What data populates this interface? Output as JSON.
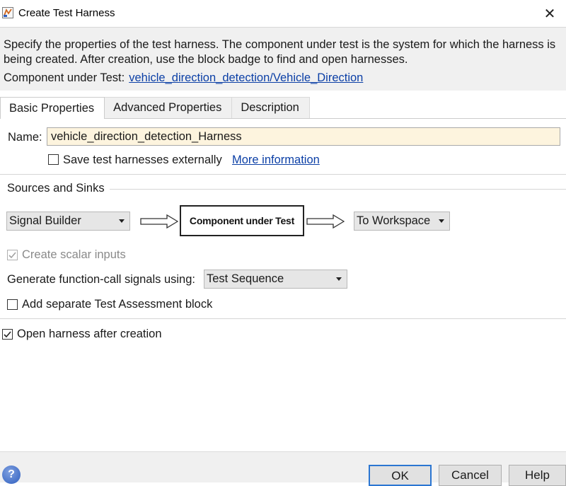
{
  "window": {
    "title": "Create Test Harness",
    "close_glyph": "✕"
  },
  "header": {
    "description": "Specify the properties of the test harness. The component under test is the system for which the harness is being created. After creation, use the block badge to find and open harnesses.",
    "component_label": "Component under Test:",
    "component_link": "vehicle_direction_detection/Vehicle_Direction"
  },
  "tabs": [
    {
      "label": "Basic Properties",
      "active": true
    },
    {
      "label": "Advanced Properties",
      "active": false
    },
    {
      "label": "Description",
      "active": false
    }
  ],
  "basic": {
    "name_label": "Name:",
    "name_value": "vehicle_direction_detection_Harness",
    "save_externally_label": "Save test harnesses externally",
    "save_externally_checked": false,
    "more_info_link": "More information"
  },
  "sources_sinks": {
    "title": "Sources and Sinks",
    "source_selected": "Signal Builder",
    "component_box": "Component under Test",
    "sink_selected": "To Workspace",
    "create_scalar_label": "Create scalar inputs",
    "create_scalar_checked": true,
    "create_scalar_enabled": false,
    "func_call_label": "Generate function-call signals using:",
    "func_call_selected": "Test Sequence",
    "separate_assessment_label": "Add separate Test Assessment block",
    "separate_assessment_checked": false
  },
  "open_after_label": "Open harness after creation",
  "open_after_checked": true,
  "footer": {
    "help_icon_glyph": "?",
    "ok_label": "OK",
    "cancel_label": "Cancel",
    "help_label": "Help"
  },
  "colors": {
    "link": "#0b3fa6",
    "name_field_bg": "#fdf4de",
    "primary_button_border": "#2b76d2"
  },
  "icons": {
    "app": "simulink-app-icon",
    "close": "close-icon",
    "help": "help-question-icon",
    "check": "checkmark-icon",
    "dropdown": "chevron-down-icon"
  }
}
